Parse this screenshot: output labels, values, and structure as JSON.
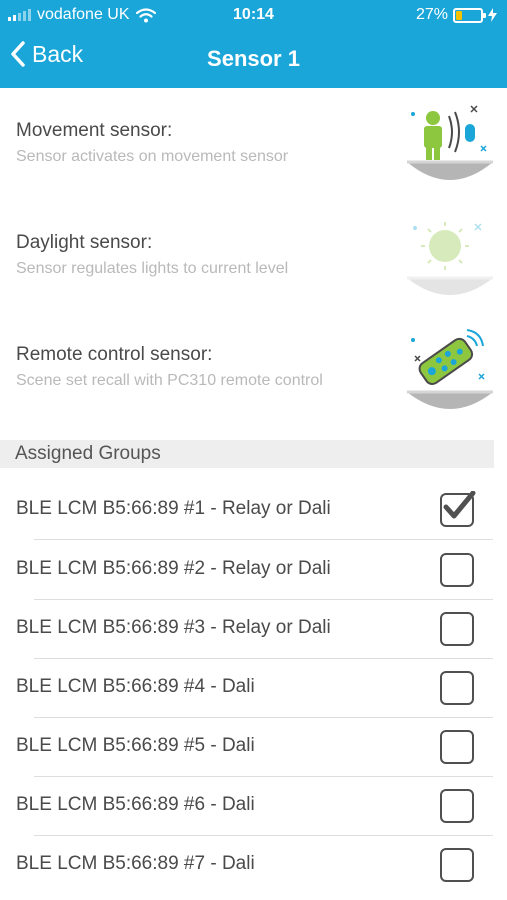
{
  "status_bar": {
    "carrier": "vodafone UK",
    "time": "10:14",
    "battery": "27%",
    "battery_level": 0.27
  },
  "nav": {
    "back_label": "Back",
    "title": "Sensor 1"
  },
  "sensors": [
    {
      "name": "Movement sensor:",
      "description": "Sensor activates on movement sensor",
      "icon": "movement-sensor-icon",
      "enabled": true
    },
    {
      "name": "Daylight sensor:",
      "description": "Sensor regulates lights to current level",
      "icon": "daylight-sensor-icon",
      "enabled": false
    },
    {
      "name": "Remote control sensor:",
      "description": "Scene set recall with PC310 remote control",
      "icon": "remote-control-icon",
      "enabled": true
    }
  ],
  "assigned_groups": {
    "header": "Assigned Groups",
    "items": [
      {
        "label": "BLE LCM B5:66:89 #1 - Relay or Dali",
        "checked": true
      },
      {
        "label": "BLE LCM B5:66:89 #2 - Relay or Dali",
        "checked": false
      },
      {
        "label": "BLE LCM B5:66:89 #3 - Relay or Dali",
        "checked": false
      },
      {
        "label": "BLE LCM B5:66:89 #4 - Dali",
        "checked": false
      },
      {
        "label": "BLE LCM B5:66:89 #5 - Dali",
        "checked": false
      },
      {
        "label": "BLE LCM B5:66:89 #6 - Dali",
        "checked": false
      },
      {
        "label": "BLE LCM B5:66:89 #7 - Dali",
        "checked": false
      }
    ]
  },
  "colors": {
    "header": "#1aa6d8",
    "battery_fill": "#f2c200",
    "icon_green": "#8dc63f",
    "icon_blue": "#1aa6d8"
  }
}
